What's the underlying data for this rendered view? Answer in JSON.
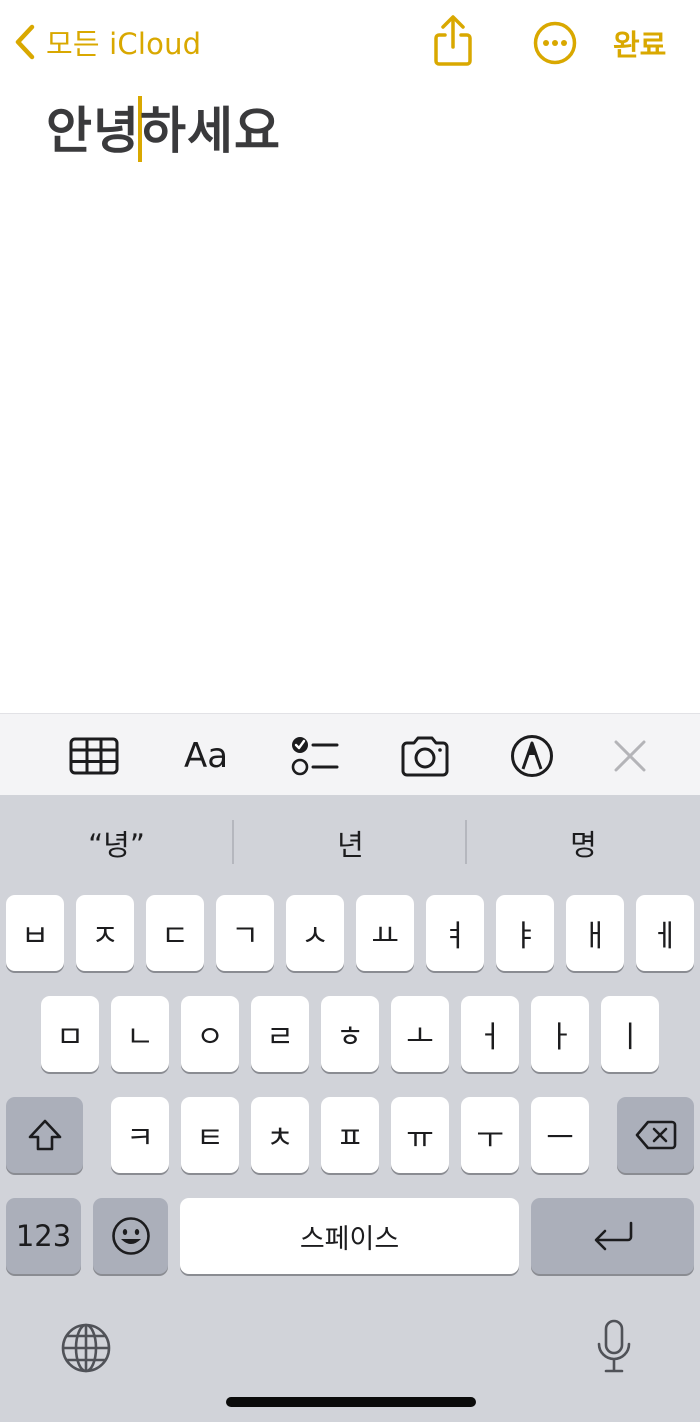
{
  "nav": {
    "back_label": "모든 iCloud",
    "done_label": "완료",
    "icons": [
      "chevron-left-icon",
      "share-icon",
      "more-icon"
    ]
  },
  "note": {
    "before_cursor": "안녕",
    "after_cursor": "하세요"
  },
  "toolbar": {
    "format_label": "Aa",
    "icons": [
      "table-icon",
      "format-icon",
      "checklist-icon",
      "camera-icon",
      "markup-icon",
      "close-icon"
    ]
  },
  "keyboard": {
    "predictions": [
      "“녕”",
      "년",
      "명"
    ],
    "row1": [
      "ㅂ",
      "ㅈ",
      "ㄷ",
      "ㄱ",
      "ㅅ",
      "ㅛ",
      "ㅕ",
      "ㅑ",
      "ㅐ",
      "ㅔ"
    ],
    "row2": [
      "ㅁ",
      "ㄴ",
      "ㅇ",
      "ㄹ",
      "ㅎ",
      "ㅗ",
      "ㅓ",
      "ㅏ",
      "ㅣ"
    ],
    "row3": [
      "ㅋ",
      "ㅌ",
      "ㅊ",
      "ㅍ",
      "ㅠ",
      "ㅜ",
      "ㅡ"
    ],
    "numbers_label": "123",
    "space_label": "스페이스",
    "icons": [
      "shift-icon",
      "delete-icon",
      "emoji-icon",
      "return-icon",
      "globe-icon",
      "microphone-icon"
    ]
  },
  "colors": {
    "accent": "#d9a800",
    "keyboard_bg": "#d1d3d9",
    "toolbar_bg": "#f4f4f6"
  }
}
